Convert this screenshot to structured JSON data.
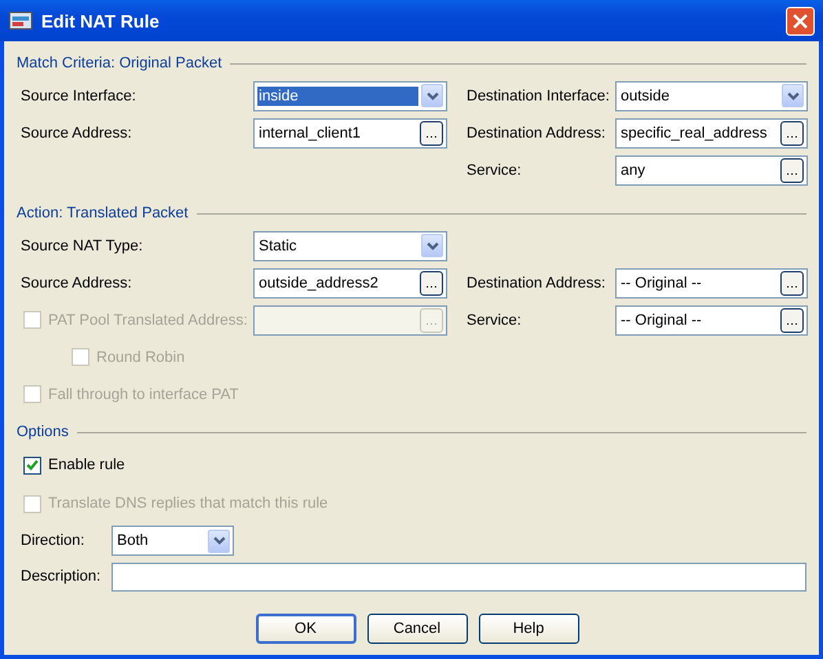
{
  "window": {
    "title": "Edit NAT Rule"
  },
  "sections": [
    {
      "title": "Match Criteria: Original Packet",
      "rows": [
        {
          "left": {
            "kind": "label",
            "label": "Source Interface:",
            "field": {
              "kind": "dropdown",
              "value": "inside",
              "highlighted": true
            }
          },
          "right": {
            "kind": "label",
            "label": "Destination Interface:",
            "field": {
              "kind": "dropdown",
              "value": "outside",
              "highlighted": false
            }
          }
        },
        {
          "left": {
            "kind": "label",
            "label": "Source Address:",
            "field": {
              "kind": "browse",
              "value": "internal_client1",
              "disabled": false
            }
          },
          "right": {
            "kind": "label",
            "label": "Destination Address:",
            "field": {
              "kind": "browse",
              "value": "specific_real_address",
              "disabled": false
            }
          }
        },
        {
          "right": {
            "kind": "label",
            "label": "Service:",
            "field": {
              "kind": "browse",
              "value": "any",
              "disabled": false
            }
          }
        }
      ]
    },
    {
      "title": "Action: Translated Packet",
      "rows": [
        {
          "left": {
            "kind": "label",
            "label": "Source NAT Type:",
            "field": {
              "kind": "dropdown",
              "value": "Static",
              "highlighted": false
            }
          }
        },
        {
          "left": {
            "kind": "label",
            "label": "Source Address:",
            "field": {
              "kind": "browse",
              "value": "outside_address2",
              "disabled": false
            }
          },
          "right": {
            "kind": "label",
            "label": "Destination Address:",
            "field": {
              "kind": "browse",
              "value": "-- Original --",
              "disabled": false
            }
          }
        },
        {
          "left": {
            "kind": "checkbox",
            "label": "PAT Pool Translated Address:",
            "checked": false,
            "disabled": true,
            "field": {
              "kind": "browse",
              "disabled": true
            }
          },
          "right": {
            "kind": "label",
            "label": "Service:",
            "field": {
              "kind": "browse",
              "value": "-- Original --",
              "disabled": false
            }
          },
          "children": [
            {
              "left": {
                "kind": "checkbox",
                "label": "Round Robin",
                "checked": false,
                "disabled": true
              }
            }
          ]
        },
        {
          "left": {
            "kind": "checkbox",
            "label": "Fall through to interface PAT",
            "checked": false,
            "disabled": true
          }
        }
      ]
    }
  ],
  "options": {
    "title": "Options",
    "checkboxes": [
      {
        "label": "Enable rule",
        "checked": true,
        "disabled": false
      },
      {
        "label": "Translate DNS replies that match this rule",
        "checked": false,
        "disabled": true
      }
    ],
    "direction": {
      "label": "Direction:",
      "value": "Both"
    },
    "description": {
      "label": "Description:"
    }
  },
  "buttons": [
    {
      "label": "OK",
      "default": true
    },
    {
      "label": "Cancel",
      "default": false
    },
    {
      "label": "Help",
      "default": false
    }
  ]
}
